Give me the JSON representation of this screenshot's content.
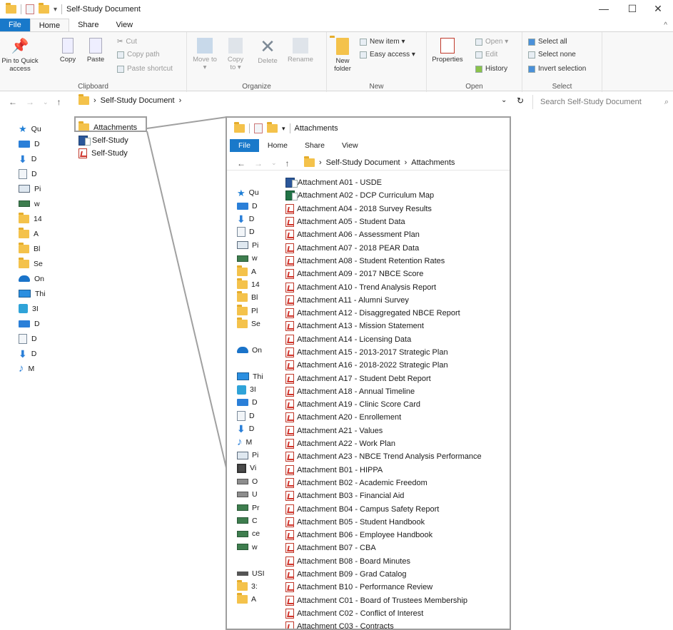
{
  "window": {
    "title": "Self-Study Document",
    "controls": {
      "minimize": "—",
      "maximize": "☐",
      "close": "✕"
    }
  },
  "ribbon": {
    "tabs": [
      "File",
      "Home",
      "Share",
      "View"
    ],
    "clipboard": {
      "label": "Clipboard",
      "pin": "Pin to Quick access",
      "copy": "Copy",
      "paste": "Paste",
      "cut": "Cut",
      "copy_path": "Copy path",
      "paste_shortcut": "Paste shortcut"
    },
    "organize": {
      "label": "Organize",
      "move_to": "Move to ▾",
      "copy_to": "Copy to ▾",
      "delete": "Delete",
      "rename": "Rename"
    },
    "new": {
      "label": "New",
      "new_folder": "New folder",
      "new_item": "New item ▾",
      "easy_access": "Easy access ▾"
    },
    "open": {
      "label": "Open",
      "properties": "Properties",
      "open": "Open ▾",
      "edit": "Edit",
      "history": "History"
    },
    "select": {
      "label": "Select",
      "select_all": "Select all",
      "select_none": "Select none",
      "invert": "Invert selection"
    }
  },
  "address": {
    "path": "Self-Study Document",
    "search_placeholder": "Search Self-Study Document"
  },
  "nav_pane": [
    {
      "icon": "star",
      "label": "Qu"
    },
    {
      "icon": "blue",
      "label": "D"
    },
    {
      "icon": "down",
      "label": "D"
    },
    {
      "icon": "docs",
      "label": "D"
    },
    {
      "icon": "pic",
      "label": "Pi"
    },
    {
      "icon": "net",
      "label": "w"
    },
    {
      "icon": "folder",
      "label": "14"
    },
    {
      "icon": "folder",
      "label": "A"
    },
    {
      "icon": "folder",
      "label": "Bl"
    },
    {
      "icon": "folder",
      "label": "Se"
    },
    {
      "icon": "cloud",
      "label": "On"
    },
    {
      "icon": "pc",
      "label": "Thi"
    },
    {
      "icon": "cube",
      "label": "3I"
    },
    {
      "icon": "blue",
      "label": "D"
    },
    {
      "icon": "docs",
      "label": "D"
    },
    {
      "icon": "down",
      "label": "D"
    },
    {
      "icon": "music",
      "label": "M"
    }
  ],
  "files": [
    {
      "type": "folder",
      "name": "Attachments"
    },
    {
      "type": "doc",
      "name": "Self-Study"
    },
    {
      "type": "pdf",
      "name": "Self-Study"
    }
  ],
  "zoom": {
    "title": "Attachments",
    "tabs": [
      "File",
      "Home",
      "Share",
      "View"
    ],
    "path": [
      "Self-Study Document",
      "Attachments"
    ],
    "nav_pane": [
      {
        "icon": "star",
        "label": "Qu"
      },
      {
        "icon": "blue",
        "label": "D"
      },
      {
        "icon": "down",
        "label": "D"
      },
      {
        "icon": "docs",
        "label": "D"
      },
      {
        "icon": "pic",
        "label": "Pi"
      },
      {
        "icon": "net",
        "label": "w"
      },
      {
        "icon": "folder",
        "label": "A"
      },
      {
        "icon": "folder",
        "label": "14"
      },
      {
        "icon": "folder",
        "label": "Bl"
      },
      {
        "icon": "folder",
        "label": "Pl"
      },
      {
        "icon": "folder",
        "label": "Se"
      },
      {
        "icon": "none",
        "label": ""
      },
      {
        "icon": "cloud",
        "label": "On"
      },
      {
        "icon": "none",
        "label": ""
      },
      {
        "icon": "pc",
        "label": "Thi"
      },
      {
        "icon": "cube",
        "label": "3I"
      },
      {
        "icon": "blue",
        "label": "D"
      },
      {
        "icon": "docs",
        "label": "D"
      },
      {
        "icon": "down",
        "label": "D"
      },
      {
        "icon": "music",
        "label": "M"
      },
      {
        "icon": "pic",
        "label": "Pi"
      },
      {
        "icon": "video",
        "label": "Vi"
      },
      {
        "icon": "drive",
        "label": "O"
      },
      {
        "icon": "drive",
        "label": "U"
      },
      {
        "icon": "net",
        "label": "Pr"
      },
      {
        "icon": "net",
        "label": "C"
      },
      {
        "icon": "net",
        "label": "ce"
      },
      {
        "icon": "net",
        "label": "w"
      },
      {
        "icon": "none",
        "label": ""
      },
      {
        "icon": "usb",
        "label": "USI"
      },
      {
        "icon": "folder",
        "label": "3:"
      },
      {
        "icon": "folder",
        "label": "A"
      }
    ],
    "files": [
      {
        "type": "doc",
        "name": "Attachment A01 - USDE"
      },
      {
        "type": "xls",
        "name": "Attachment A02 - DCP Curriculum Map"
      },
      {
        "type": "pdf",
        "name": "Attachment A04 - 2018 Survey Results"
      },
      {
        "type": "pdf",
        "name": "Attachment A05 - Student Data"
      },
      {
        "type": "pdf",
        "name": "Attachment A06 - Assessment Plan"
      },
      {
        "type": "pdf",
        "name": "Attachment A07 - 2018 PEAR Data"
      },
      {
        "type": "pdf",
        "name": "Attachment A08 - Student Retention Rates"
      },
      {
        "type": "pdf",
        "name": "Attachment A09 - 2017 NBCE Score"
      },
      {
        "type": "pdf",
        "name": "Attachment A10 - Trend Analysis Report"
      },
      {
        "type": "pdf",
        "name": "Attachment A11 - Alumni Survey"
      },
      {
        "type": "pdf",
        "name": "Attachment A12 - Disaggregated NBCE Report"
      },
      {
        "type": "pdf",
        "name": "Attachment A13 - Mission Statement"
      },
      {
        "type": "pdf",
        "name": "Attachment A14 - Licensing Data"
      },
      {
        "type": "pdf",
        "name": "Attachment A15 - 2013-2017 Strategic Plan"
      },
      {
        "type": "pdf",
        "name": "Attachment A16 - 2018-2022 Strategic Plan"
      },
      {
        "type": "pdf",
        "name": "Attachment A17 - Student Debt Report"
      },
      {
        "type": "pdf",
        "name": "Attachment A18 - Annual Timeline"
      },
      {
        "type": "pdf",
        "name": "Attachment A19 - Clinic Score Card"
      },
      {
        "type": "pdf",
        "name": "Attachment A20 - Enrollement"
      },
      {
        "type": "pdf",
        "name": "Attachment A21 - Values"
      },
      {
        "type": "pdf",
        "name": "Attachment A22 - Work Plan"
      },
      {
        "type": "pdf",
        "name": "Attachment A23 - NBCE Trend Analysis Performance"
      },
      {
        "type": "pdf",
        "name": "Attachment B01 - HIPPA"
      },
      {
        "type": "pdf",
        "name": "Attachment B02 - Academic Freedom"
      },
      {
        "type": "pdf",
        "name": "Attachment B03 - Financial Aid"
      },
      {
        "type": "pdf",
        "name": "Attachment B04 - Campus Safety Report"
      },
      {
        "type": "pdf",
        "name": "Attachment B05 - Student Handbook"
      },
      {
        "type": "pdf",
        "name": "Attachment B06 - Employee Handbook"
      },
      {
        "type": "pdf",
        "name": "Attachment B07 - CBA"
      },
      {
        "type": "pdf",
        "name": "Attachment B08 - Board Minutes"
      },
      {
        "type": "pdf",
        "name": "Attachment B09 - Grad Catalog"
      },
      {
        "type": "pdf",
        "name": "Attachment B10 - Performance Review"
      },
      {
        "type": "pdf",
        "name": "Attachment C01 - Board of Trustees Membership"
      },
      {
        "type": "pdf",
        "name": "Attachment C02 - Conflict of Interest"
      },
      {
        "type": "pdf",
        "name": "Attachment C03 - Contracts"
      }
    ]
  }
}
